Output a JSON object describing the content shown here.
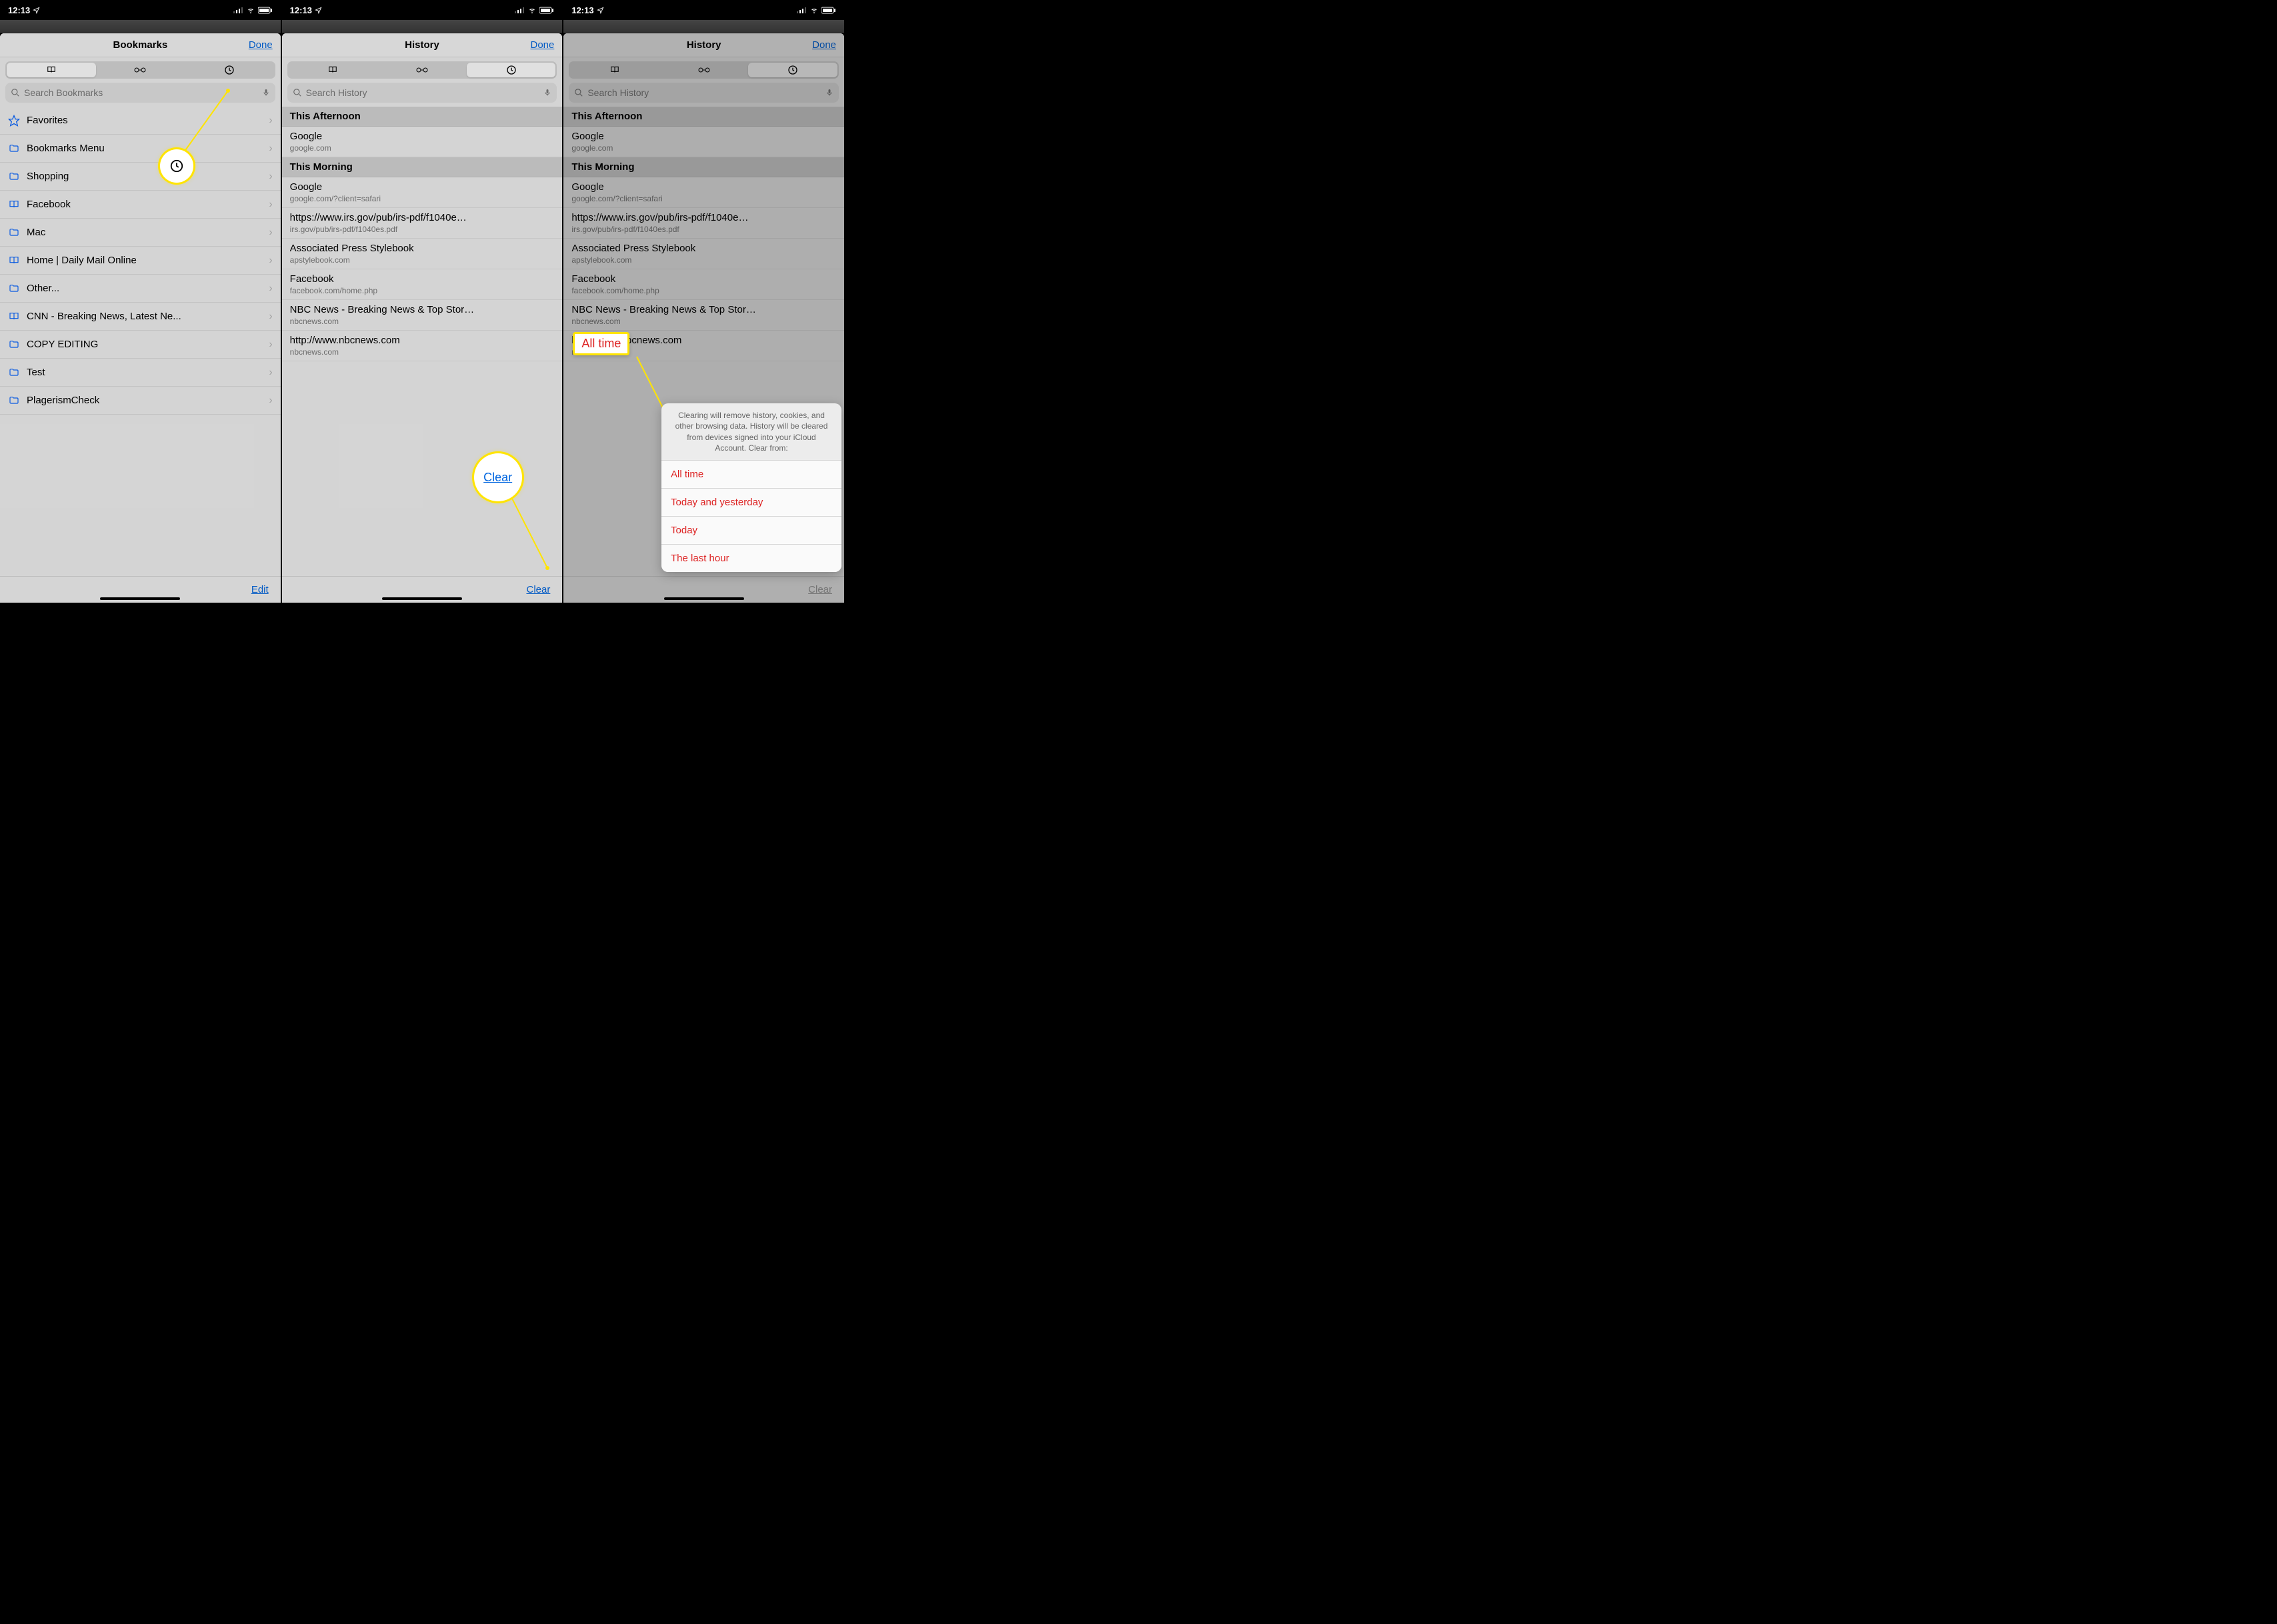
{
  "status": {
    "time": "12:13",
    "loc_icon": "◤"
  },
  "screens": [
    {
      "title": "Bookmarks",
      "done": "Done",
      "active_tab": 0,
      "search_ph": "Search Bookmarks",
      "toolbar_label": "Edit",
      "rows": [
        {
          "icon": "star",
          "label": "Favorites"
        },
        {
          "icon": "folder",
          "label": "Bookmarks Menu"
        },
        {
          "icon": "folder",
          "label": "Shopping"
        },
        {
          "icon": "book",
          "label": "Facebook"
        },
        {
          "icon": "folder",
          "label": "Mac"
        },
        {
          "icon": "book",
          "label": "Home | Daily Mail Online"
        },
        {
          "icon": "folder",
          "label": "Other..."
        },
        {
          "icon": "book",
          "label": "CNN - Breaking News, Latest Ne..."
        },
        {
          "icon": "folder",
          "label": "COPY EDITING"
        },
        {
          "icon": "folder",
          "label": "Test"
        },
        {
          "icon": "folder",
          "label": "PlagerismCheck"
        }
      ],
      "callout_top_icon": "clock"
    },
    {
      "title": "History",
      "done": "Done",
      "active_tab": 2,
      "search_ph": "Search History",
      "toolbar_label": "Clear",
      "sections": [
        {
          "head": "This Afternoon",
          "items": [
            {
              "t": "Google",
              "s": "google.com"
            }
          ]
        },
        {
          "head": "This Morning",
          "items": [
            {
              "t": "Google",
              "s": "google.com/?client=safari"
            },
            {
              "t": "https://www.irs.gov/pub/irs-pdf/f1040e…",
              "s": "irs.gov/pub/irs-pdf/f1040es.pdf"
            },
            {
              "t": "Associated Press Stylebook",
              "s": "apstylebook.com"
            },
            {
              "t": "Facebook",
              "s": "facebook.com/home.php"
            },
            {
              "t": "NBC News - Breaking News & Top Stor…",
              "s": "nbcnews.com"
            },
            {
              "t": "http://www.nbcnews.com",
              "s": "nbcnews.com"
            }
          ]
        }
      ],
      "callout_label": "Clear"
    },
    {
      "title": "History",
      "done": "Done",
      "active_tab": 2,
      "search_ph": "Search History",
      "toolbar_label": "Clear",
      "sections": [
        {
          "head": "This Afternoon",
          "items": [
            {
              "t": "Google",
              "s": "google.com"
            }
          ]
        },
        {
          "head": "This Morning",
          "items": [
            {
              "t": "Google",
              "s": "google.com/?client=safari"
            },
            {
              "t": "https://www.irs.gov/pub/irs-pdf/f1040e…",
              "s": "irs.gov/pub/irs-pdf/f1040es.pdf"
            },
            {
              "t": "Associated Press Stylebook",
              "s": "apstylebook.com"
            },
            {
              "t": "Facebook",
              "s": "facebook.com/home.php"
            },
            {
              "t": "NBC News - Breaking News & Top Stor…",
              "s": "nbcnews.com"
            },
            {
              "t": "http://www.nbcnews.com",
              "s": "nbcnews.com"
            }
          ]
        }
      ],
      "popup": {
        "message": "Clearing will remove history, cookies, and other browsing data. History will be cleared from devices signed into your iCloud Account. Clear from:",
        "options": [
          "All time",
          "Today and yesterday",
          "Today",
          "The last hour"
        ]
      },
      "tag_label": "All time"
    }
  ]
}
